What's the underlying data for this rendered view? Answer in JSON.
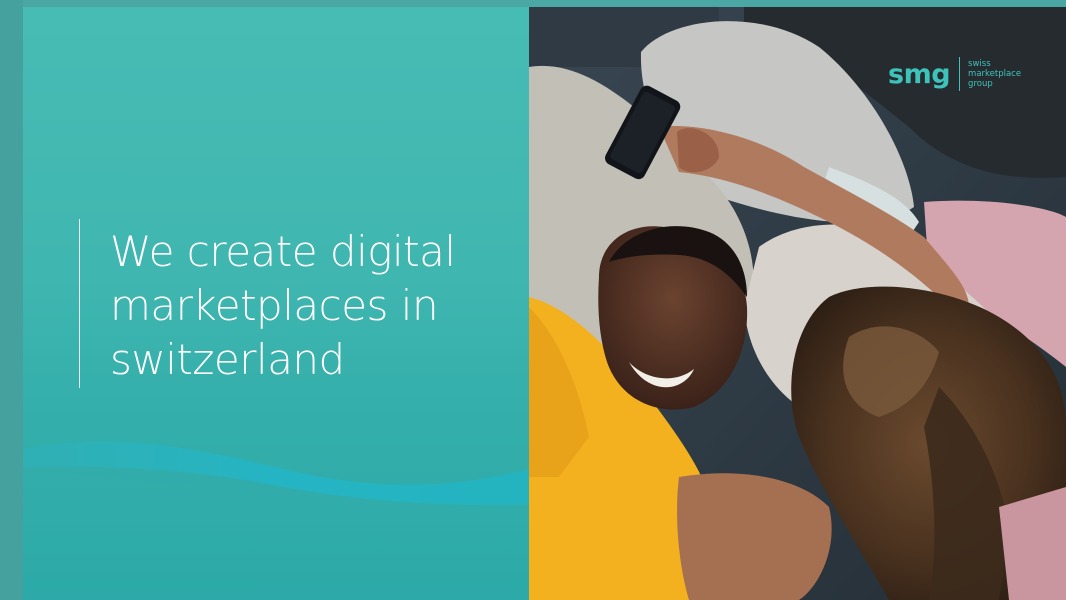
{
  "headline": {
    "line1": "We create digital",
    "line2": "marketplaces in",
    "line3": "switzerland"
  },
  "logo": {
    "mark": "smg",
    "line1": "swiss",
    "line2": "marketplace",
    "line3": "group"
  },
  "colors": {
    "teal_background": "#47bcb5",
    "accent_teal": "#3ec3bb",
    "headline_text": "#ffffff",
    "shirt_yellow": "#f4b11f"
  },
  "photo": {
    "subject": "couple-relaxing-on-sofa-photo"
  }
}
